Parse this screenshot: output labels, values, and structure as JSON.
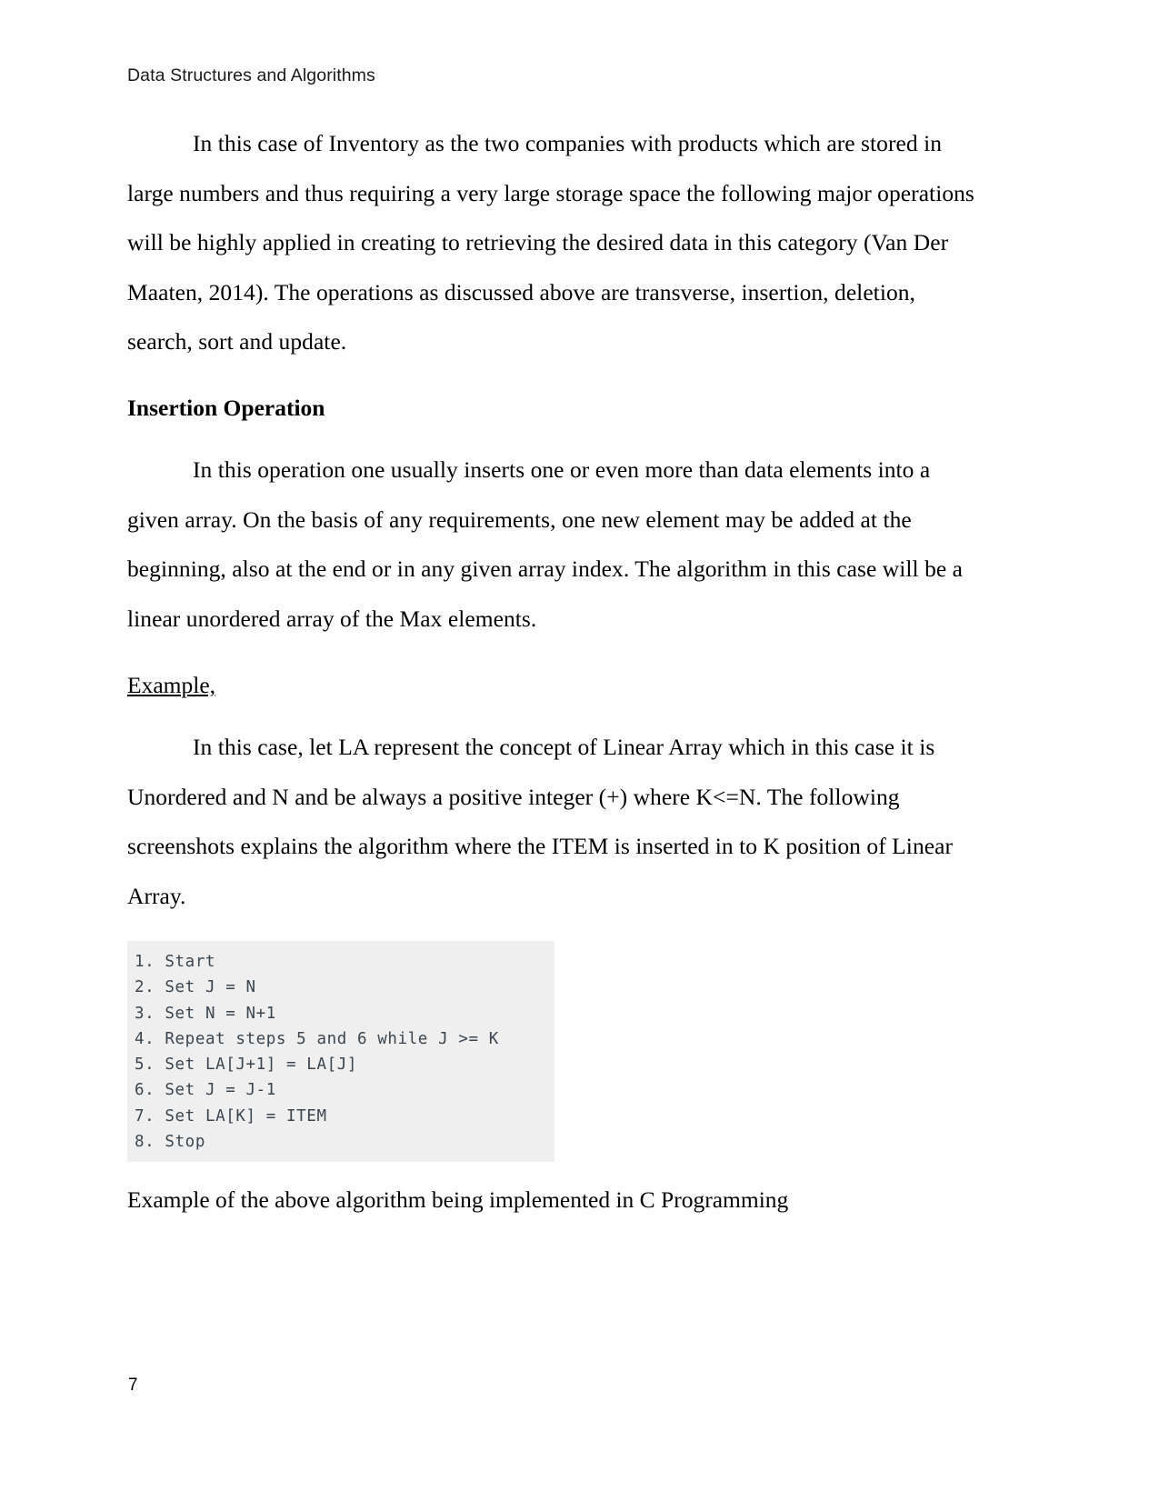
{
  "document": {
    "running_header": "Data Structures and Algorithms",
    "page_number": "7"
  },
  "paragraphs": {
    "intro": "In this case of Inventory as the two companies with products which are stored in large numbers and thus requiring a very large storage space the following major operations will be highly applied in creating to retrieving the desired data in this category (Van Der Maaten, 2014). The operations as discussed above are transverse, insertion, deletion, search, sort and update.",
    "insertion_body": "In this operation one usually inserts one or even more than data elements into a given array. On the basis of any requirements, one new element may be added at the beginning, also at the end or in any given array index. The algorithm in this case will be a linear unordered array of the Max elements.",
    "example_body": "In this case, let LA represent the concept of Linear Array which in this case it is Unordered and N and be always a positive integer (+) where K<=N. The following screenshots explains the algorithm where the ITEM is inserted in to K position of Linear Array."
  },
  "headings": {
    "insertion_operation": "Insertion Operation",
    "example_label": "Example,"
  },
  "code_block": {
    "background_color": "#efefef",
    "text_color": "#3b4650",
    "lines": [
      "1. Start",
      "2. Set J = N",
      "3. Set N = N+1",
      "4. Repeat steps 5 and 6 while J >= K",
      "5. Set LA[J+1] = LA[J]",
      "6. Set J = J-1",
      "7. Set LA[K] = ITEM",
      "8. Stop"
    ]
  },
  "caption": "Example of the above algorithm being implemented in C Programming"
}
